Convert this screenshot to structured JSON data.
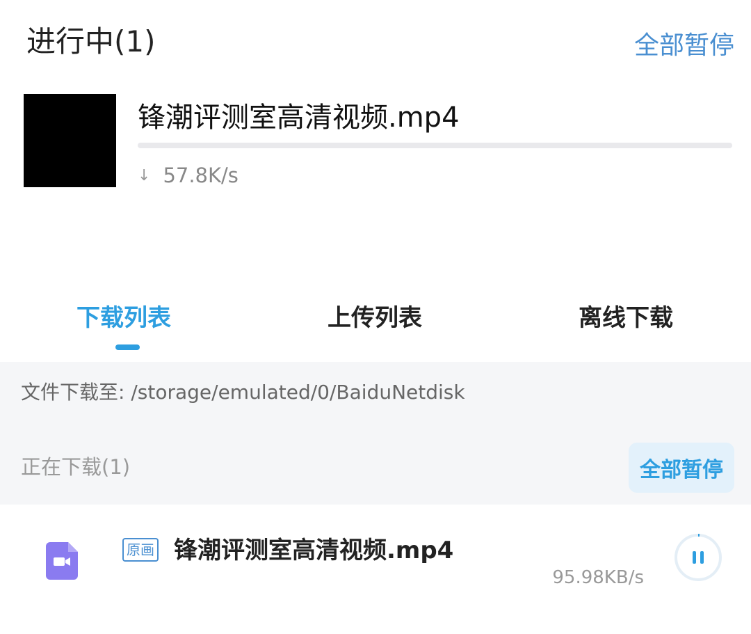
{
  "top": {
    "title": "进行中(1)",
    "pause_all": "全部暂停",
    "file_name": "锋潮评测室高清视频.mp4",
    "speed": "57.8K/s",
    "progress": 0
  },
  "tabs": [
    {
      "label": "下载列表",
      "active": true
    },
    {
      "label": "上传列表",
      "active": false
    },
    {
      "label": "离线下载",
      "active": false
    }
  ],
  "path": "文件下载至: /storage/emulated/0/BaiduNetdisk",
  "section": {
    "title": "正在下载(1)",
    "pause_all": "全部暂停"
  },
  "download": {
    "quality_badge": "原画",
    "file_name": "锋潮评测室高清视频.mp4",
    "speed": "95.98KB/s",
    "icon": "video-file-icon",
    "action_icon": "pause-icon"
  },
  "colors": {
    "accent": "#2d9ee0",
    "link": "#4a8fd1",
    "file_icon": "#8a7bf0"
  }
}
